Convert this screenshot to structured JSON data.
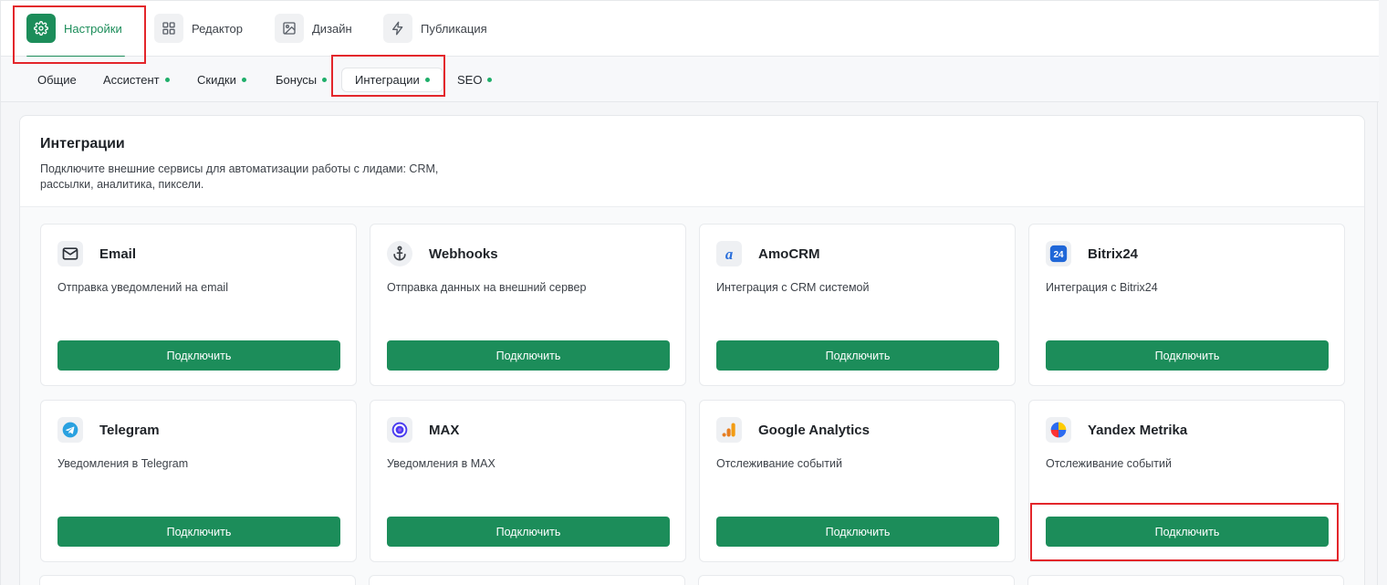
{
  "top_nav": {
    "items": [
      {
        "label": "Настройки",
        "icon": "gear-icon",
        "active": true
      },
      {
        "label": "Редактор",
        "icon": "grid-icon",
        "active": false
      },
      {
        "label": "Дизайн",
        "icon": "image-icon",
        "active": false
      },
      {
        "label": "Публикация",
        "icon": "lightning-icon",
        "active": false
      }
    ]
  },
  "sub_tabs": [
    {
      "label": "Общие",
      "dot": false,
      "active": false
    },
    {
      "label": "Ассистент",
      "dot": true,
      "active": false
    },
    {
      "label": "Скидки",
      "dot": true,
      "active": false
    },
    {
      "label": "Бонусы",
      "dot": true,
      "active": false
    },
    {
      "label": "Интеграции",
      "dot": true,
      "active": true
    },
    {
      "label": "SEO",
      "dot": true,
      "active": false
    }
  ],
  "panel": {
    "title": "Интеграции",
    "description": "Подключите внешние сервисы для автоматизации работы с лидами: CRM, рассылки, аналитика, пиксели."
  },
  "integrations": [
    {
      "title": "Email",
      "description": "Отправка уведомлений на email",
      "button": "Подключить",
      "icon": "mail-icon"
    },
    {
      "title": "Webhooks",
      "description": "Отправка данных на внешний сервер",
      "button": "Подключить",
      "icon": "anchor-icon"
    },
    {
      "title": "AmoCRM",
      "description": "Интеграция с CRM системой",
      "button": "Подключить",
      "icon": "amocrm-logo-icon"
    },
    {
      "title": "Bitrix24",
      "description": "Интеграция с Bitrix24",
      "button": "Подключить",
      "icon": "bitrix24-logo-icon"
    },
    {
      "title": "Telegram",
      "description": "Уведомления в Telegram",
      "button": "Подключить",
      "icon": "telegram-logo-icon"
    },
    {
      "title": "MAX",
      "description": "Уведомления в MAX",
      "button": "Подключить",
      "icon": "max-logo-icon"
    },
    {
      "title": "Google Analytics",
      "description": "Отслеживание событий",
      "button": "Подключить",
      "icon": "google-analytics-logo-icon"
    },
    {
      "title": "Yandex Metrika",
      "description": "Отслеживание событий",
      "button": "Подключить",
      "icon": "yandex-metrika-logo-icon"
    }
  ],
  "colors": {
    "accent": "#1c8d5a",
    "dot": "#1fae6a",
    "highlight": "#e3262b"
  }
}
